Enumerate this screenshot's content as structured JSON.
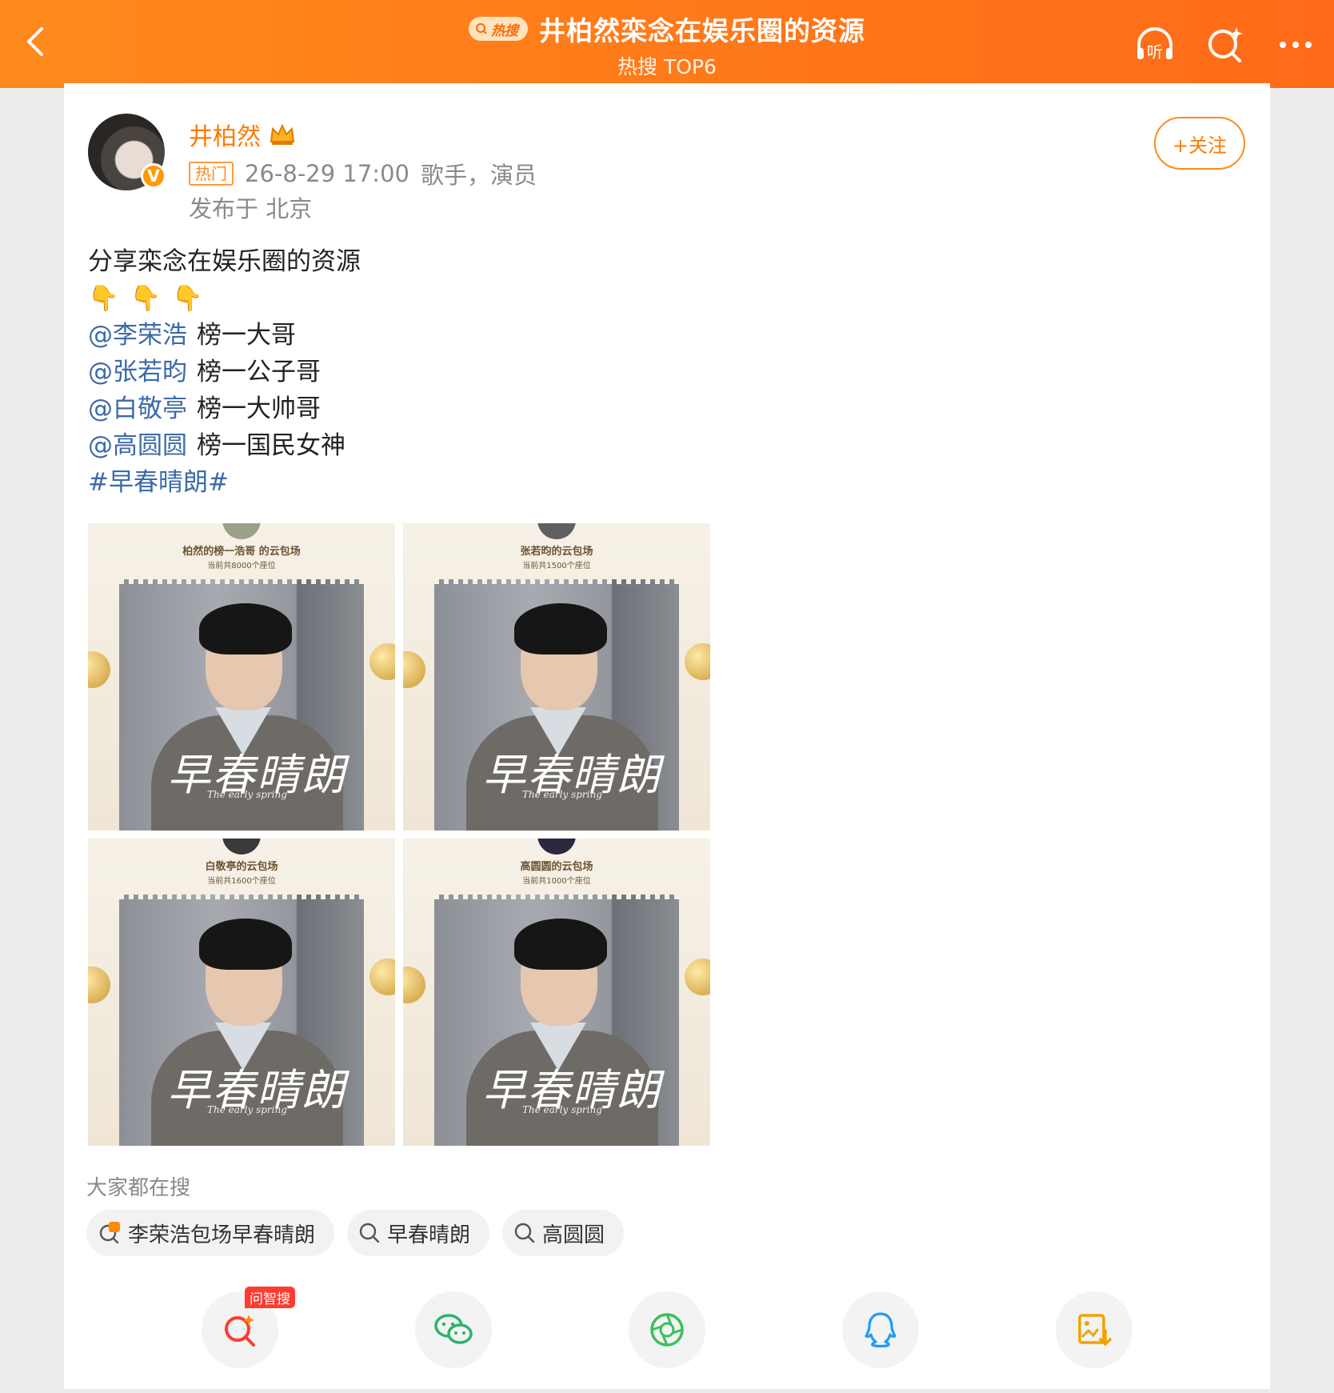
{
  "header": {
    "hot_badge": "热搜",
    "title": "井柏然栾念在娱乐圈的资源",
    "subtitle": "热搜 TOP6",
    "listen_label": "听"
  },
  "post": {
    "author": "井柏然",
    "hot_tag": "热门",
    "time": "26-8-29 17:00",
    "bio": "歌手，演员",
    "location": "发布于 北京",
    "follow_label": "+关注",
    "verified_mark": "V",
    "text_line1": "分享栾念在娱乐圈的资源",
    "emojis": [
      "👇",
      "👇",
      "👇"
    ],
    "mentions": [
      {
        "name": "@李荣浩",
        "desc": "榜一大哥"
      },
      {
        "name": "@张若昀",
        "desc": "榜一公子哥"
      },
      {
        "name": "@白敬亭",
        "desc": "榜一大帅哥"
      },
      {
        "name": "@高圆圆",
        "desc": "榜一国民女神"
      }
    ],
    "hashtag": "#早春晴朗#"
  },
  "images": [
    {
      "title": "柏然的榜一浩哥 的云包场",
      "sub": "当前共8000个座位",
      "poster_title": "早春晴朗",
      "poster_sub": "The early spring"
    },
    {
      "title": "张若昀的云包场",
      "sub": "当前共1500个座位",
      "poster_title": "早春晴朗",
      "poster_sub": "The early spring"
    },
    {
      "title": "白敬亭的云包场",
      "sub": "当前共1600个座位",
      "poster_title": "早春晴朗",
      "poster_sub": "The early spring"
    },
    {
      "title": "高圆圆的云包场",
      "sub": "当前共1000个座位",
      "poster_title": "早春晴朗",
      "poster_sub": "The early spring"
    }
  ],
  "searches": {
    "label": "大家都在搜",
    "items": [
      "李荣浩包场早春晴朗",
      "早春晴朗",
      "高圆圆"
    ]
  },
  "share": {
    "ask_badge": "问智搜",
    "icons": [
      "ask-search-icon",
      "wechat-icon",
      "moments-icon",
      "qq-icon",
      "save-image-icon"
    ]
  },
  "colors": {
    "accent": "#ff7a00",
    "link": "#3c6aa8",
    "header_bg": "#ff7a1a"
  }
}
